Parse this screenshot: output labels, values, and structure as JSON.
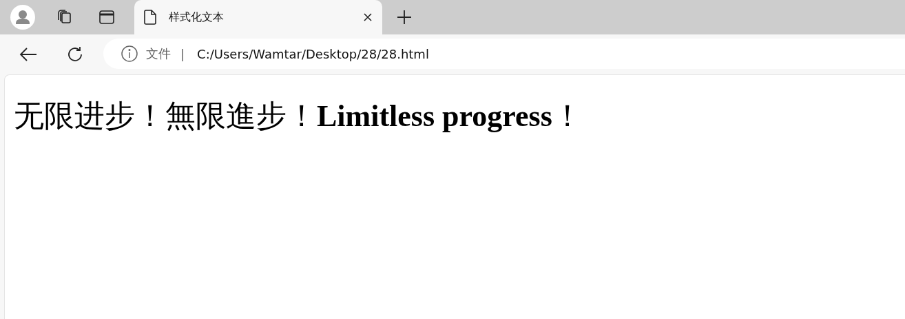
{
  "tabs": [
    {
      "title": "样式化文本",
      "selected": true
    }
  ],
  "address_bar": {
    "scheme_label": "文件",
    "separator": "|",
    "url": "C:/Users/Wamtar/Desktop/28/28.html"
  },
  "page": {
    "heading": "无限进步！無限進步！**Limitless progress**！"
  }
}
